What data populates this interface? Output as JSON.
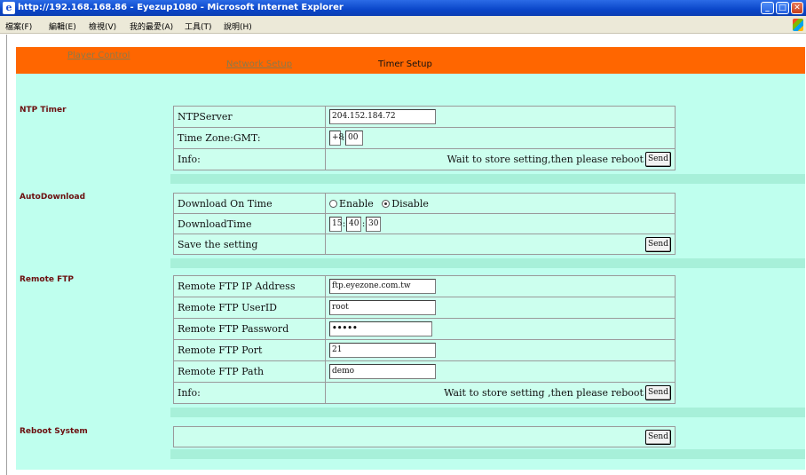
{
  "window": {
    "title": "http://192.168.168.86 - Eyezup1080 - Microsoft Internet Explorer",
    "min": "_",
    "max": "□",
    "close": "✕"
  },
  "menu": [
    "檔案(F)",
    "編輯(E)",
    "檢視(V)",
    "我的最愛(A)",
    "工具(T)",
    "說明(H)"
  ],
  "nav": {
    "player_control": "Player Control",
    "network_setup": "Network Setup",
    "timer_setup": "Timer Setup"
  },
  "ntp": {
    "section": "NTP Timer",
    "server_label": "NTPServer",
    "server_value": "204.152.184.72",
    "tz_label": "Time Zone:GMT:",
    "tz_hours": "+8",
    "tz_minutes": "00",
    "info_label": "Info:",
    "info_note": "Wait to store setting,then please reboot",
    "send": "Send"
  },
  "auto": {
    "section": "AutoDownload",
    "ontime_label": "Download On Time",
    "enable": "Enable",
    "disable": "Disable",
    "selected": "Disable",
    "time_label": "DownloadTime",
    "hh": "15",
    "mm": "40",
    "ss": "30",
    "save_label": "Save the setting",
    "send": "Send"
  },
  "ftp": {
    "section": "Remote FTP",
    "ip_label": "Remote FTP IP Address",
    "ip_value": "ftp.eyezone.com.tw",
    "user_label": "Remote FTP UserID",
    "user_value": "root",
    "pass_label": "Remote FTP Password",
    "pass_value": "•••••",
    "port_label": "Remote FTP Port",
    "port_value": "21",
    "path_label": "Remote FTP Path",
    "path_value": "demo",
    "info_label": "Info:",
    "info_note": "Wait to store setting ,then please reboot",
    "send": "Send"
  },
  "reboot": {
    "section": "Reboot System",
    "send": "Send"
  }
}
